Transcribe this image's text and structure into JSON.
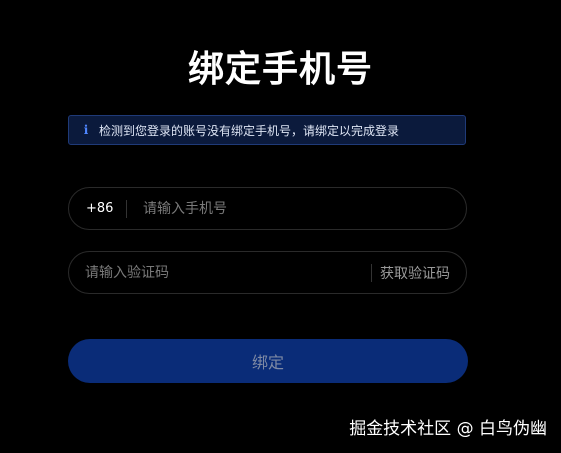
{
  "title": "绑定手机号",
  "notice": {
    "icon": "info-icon",
    "text": "检测到您登录的账号没有绑定手机号，请绑定以完成登录"
  },
  "phone": {
    "prefix": "+86",
    "placeholder": "请输入手机号"
  },
  "code": {
    "placeholder": "请输入验证码",
    "get_code_label": "获取验证码"
  },
  "submit_label": "绑定",
  "watermark": "掘金技术社区 @ 白鸟伪幽",
  "colors": {
    "background": "#000000",
    "primary_button": "#0a2c78",
    "notice_bg": "#0b1a3c",
    "notice_border": "#1f3a78",
    "info_icon": "#4f86ff"
  }
}
